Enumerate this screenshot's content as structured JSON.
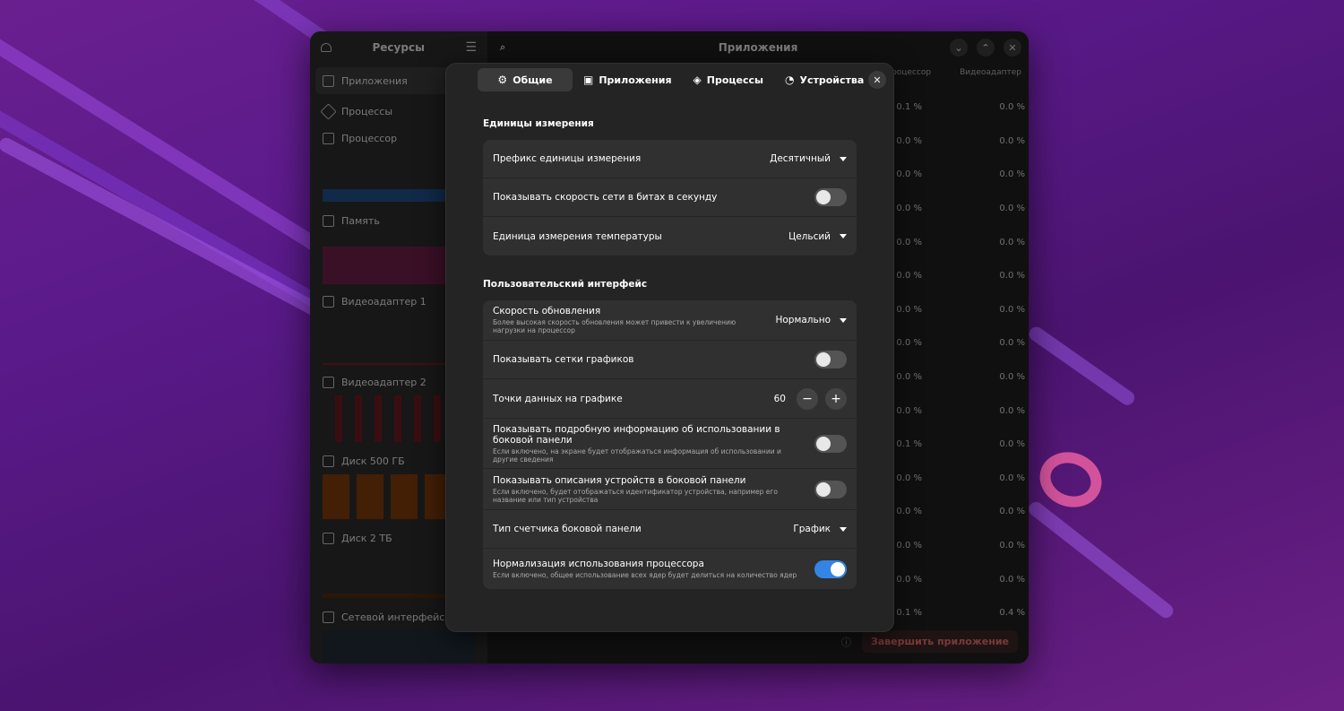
{
  "app": {
    "sidebar_title": "Ресурсы",
    "main_title": "Приложения",
    "sidebar_items": [
      {
        "label": "Приложения",
        "icon": "window-icon"
      },
      {
        "label": "Процессы",
        "icon": "processes-icon"
      },
      {
        "label": "Процессор",
        "icon": "cpu-icon"
      },
      {
        "label": "Память",
        "icon": "memory-icon"
      },
      {
        "label": "Видеоадаптер 1",
        "icon": "gpu-icon"
      },
      {
        "label": "Видеоадаптер 2",
        "icon": "gpu-icon"
      },
      {
        "label": "Диск 500 ГБ",
        "icon": "disk-icon"
      },
      {
        "label": "Диск 2 ТБ",
        "icon": "disk-icon"
      },
      {
        "label": "Сетевой интерфейс",
        "icon": "network-icon"
      }
    ],
    "columns": [
      "Процессор",
      "Видеоадаптер"
    ],
    "rows": [
      [
        "0.1 %",
        "0.0 %"
      ],
      [
        "0.0 %",
        "0.0 %"
      ],
      [
        "0.0 %",
        "0.0 %"
      ],
      [
        "0.0 %",
        "0.0 %"
      ],
      [
        "0.0 %",
        "0.0 %"
      ],
      [
        "0.0 %",
        "0.0 %"
      ],
      [
        "0.0 %",
        "0.0 %"
      ],
      [
        "0.0 %",
        "0.0 %"
      ],
      [
        "0.0 %",
        "0.0 %"
      ],
      [
        "0.0 %",
        "0.0 %"
      ],
      [
        "0.1 %",
        "0.0 %"
      ],
      [
        "0.0 %",
        "0.0 %"
      ],
      [
        "0.0 %",
        "0.0 %"
      ],
      [
        "0.0 %",
        "0.0 %"
      ],
      [
        "0.0 %",
        "0.0 %"
      ],
      [
        "0.1 %",
        "0.4 %"
      ]
    ],
    "end_button": "Завершить приложение"
  },
  "dialog": {
    "tabs": [
      {
        "label": "Общие",
        "icon": "gear-icon"
      },
      {
        "label": "Приложения",
        "icon": "window-icon"
      },
      {
        "label": "Процессы",
        "icon": "processes-icon"
      },
      {
        "label": "Устройства",
        "icon": "gauge-icon"
      }
    ],
    "units_section": {
      "title": "Единицы измерения",
      "prefix_label": "Префикс единицы измерения",
      "prefix_value": "Десятичный",
      "bits_label": "Показывать скорость сети в битах в секунду",
      "bits_on": false,
      "temp_label": "Единица измерения температуры",
      "temp_value": "Цельсий"
    },
    "ui_section": {
      "title": "Пользовательский интерфейс",
      "refresh_label": "Скорость обновления",
      "refresh_sub": "Более высокая скорость обновления может привести к увеличению нагрузки на процессор",
      "refresh_value": "Нормально",
      "grid_label": "Показывать сетки графиков",
      "grid_on": false,
      "points_label": "Точки данных на графике",
      "points_value": "60",
      "detail_label": "Показывать подробную информацию об использовании в боковой панели",
      "detail_sub": "Если включено, на экране будет отображаться информация об использовании и другие сведения",
      "detail_on": false,
      "desc_label": "Показывать описания устройств в боковой панели",
      "desc_sub": "Если включено, будет отображаться идентификатор устройства, например его название или тип устройства",
      "desc_on": false,
      "meter_label": "Тип счетчика боковой панели",
      "meter_value": "График",
      "normalize_label": "Нормализация использования процессора",
      "normalize_sub": "Если включено, общее использование всех ядер будет делиться на количество ядер",
      "normalize_on": true
    }
  },
  "colors": {
    "accent": "#3584e4",
    "cpu_graph": "#3584e4",
    "memory_graph": "#c0307a",
    "gpu_graph": "#c01c28",
    "disk_graph": "#e66100",
    "network_graph": "#2c5f8a"
  }
}
